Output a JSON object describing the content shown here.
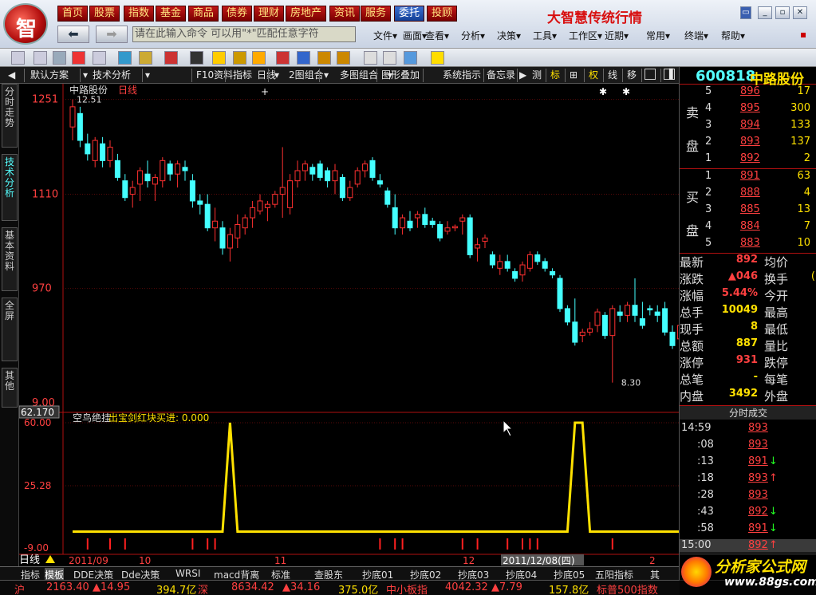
{
  "app": {
    "title": "大智慧传统行情",
    "logo_char": "智"
  },
  "nav": [
    "首页",
    "股票",
    "指数",
    "基金",
    "商品",
    "债券",
    "理财",
    "房地产",
    "资讯",
    "服务",
    "委托",
    "投顾"
  ],
  "command": {
    "placeholder": "请在此输入命令   可以用\"*\"匹配任意字符"
  },
  "menu": [
    "文件▾",
    "画面▾",
    "查看▾",
    "分析▾",
    "决策▾",
    "工具▾",
    "工作区▾",
    "近期▾",
    "常用▾",
    "终端▾",
    "帮助▾"
  ],
  "window_buttons": [
    "_",
    "▫",
    "✕"
  ],
  "tabs": [
    "◀",
    "默认方案",
    "▾",
    "技术分析",
    "▾",
    "F10资料",
    "指标",
    "日线",
    "▾",
    "2图组合",
    "▾",
    "多图组合",
    "▾",
    "图形叠加",
    "系统指示",
    "备忘录",
    "▶",
    "测",
    "标",
    "⊞",
    "权",
    "线",
    "移"
  ],
  "side_tabs": [
    "分时走势",
    "技术分析",
    "基本资料",
    "全屏",
    "其他"
  ],
  "stock": {
    "code": "600818",
    "name": "中路股份",
    "period": "日线"
  },
  "main_chart": {
    "high_label": "12.51",
    "low_label": "8.30",
    "y_ticks": [
      "1251",
      "1110",
      "970",
      "9.00"
    ],
    "left_readout": "62.170"
  },
  "indicator": {
    "name": "空鸟绝挂",
    "signal_label": "出宝剑红块买进: 0.000",
    "y_ticks": [
      "60.00",
      "25.28",
      "-9.00"
    ]
  },
  "x_labels": [
    "2011/09",
    "10",
    "11",
    "12",
    "2011/12/08(四)",
    "2"
  ],
  "period_label": "日线",
  "chart_data": {
    "type": "candlestick",
    "ylim": [
      8.0,
      12.6
    ],
    "candles": [
      [
        12.1,
        12.51,
        11.9,
        12.4
      ],
      [
        12.3,
        12.4,
        11.8,
        11.9
      ],
      [
        11.85,
        12.0,
        11.6,
        11.7
      ],
      [
        11.6,
        11.95,
        11.5,
        11.9
      ],
      [
        11.85,
        11.95,
        11.5,
        11.6
      ],
      [
        11.6,
        11.9,
        11.5,
        11.8
      ],
      [
        11.6,
        11.7,
        11.3,
        11.35
      ],
      [
        11.3,
        11.4,
        11.0,
        11.05
      ],
      [
        11.1,
        11.3,
        10.9,
        11.2
      ],
      [
        11.25,
        11.5,
        11.0,
        11.45
      ],
      [
        11.4,
        11.6,
        11.2,
        11.3
      ],
      [
        11.25,
        11.4,
        11.0,
        11.35
      ],
      [
        11.3,
        11.65,
        11.2,
        11.6
      ],
      [
        11.55,
        11.6,
        11.3,
        11.4
      ],
      [
        11.4,
        11.6,
        11.2,
        11.55
      ],
      [
        11.5,
        11.6,
        11.3,
        11.45
      ],
      [
        11.3,
        11.4,
        10.9,
        11.0
      ],
      [
        11.0,
        11.1,
        10.8,
        10.95
      ],
      [
        10.95,
        11.1,
        10.55,
        10.6
      ],
      [
        10.6,
        10.9,
        10.4,
        10.7
      ],
      [
        10.6,
        10.7,
        10.2,
        10.3
      ],
      [
        10.3,
        10.6,
        10.1,
        10.5
      ],
      [
        10.45,
        10.8,
        10.3,
        10.65
      ],
      [
        10.6,
        10.8,
        10.5,
        10.75
      ],
      [
        10.75,
        11.0,
        10.6,
        10.9
      ],
      [
        10.85,
        11.1,
        10.8,
        11.0
      ],
      [
        10.9,
        11.0,
        10.7,
        10.95
      ],
      [
        10.95,
        11.15,
        10.9,
        11.1
      ],
      [
        11.1,
        11.8,
        10.75,
        11.2
      ],
      [
        10.9,
        11.4,
        10.8,
        11.3
      ],
      [
        11.3,
        11.6,
        11.2,
        11.45
      ],
      [
        11.45,
        11.6,
        11.3,
        11.55
      ],
      [
        11.5,
        11.55,
        11.3,
        11.4
      ],
      [
        11.55,
        11.6,
        11.3,
        11.35
      ],
      [
        11.45,
        11.5,
        11.2,
        11.3
      ],
      [
        11.3,
        11.55,
        11.1,
        11.45
      ],
      [
        11.35,
        11.4,
        11.0,
        11.05
      ],
      [
        11.05,
        11.3,
        11.0,
        11.2
      ],
      [
        11.25,
        11.5,
        11.2,
        11.45
      ],
      [
        11.45,
        11.6,
        11.35,
        11.55
      ],
      [
        11.6,
        11.65,
        11.3,
        11.35
      ],
      [
        11.3,
        11.4,
        11.2,
        11.25
      ],
      [
        11.15,
        11.2,
        10.9,
        10.95
      ],
      [
        10.9,
        11.1,
        10.5,
        10.6
      ],
      [
        10.6,
        10.8,
        10.5,
        10.75
      ],
      [
        10.7,
        10.85,
        10.55,
        10.6
      ],
      [
        10.75,
        10.85,
        10.6,
        10.8
      ],
      [
        10.8,
        10.9,
        10.6,
        10.65
      ],
      [
        10.7,
        10.75,
        10.6,
        10.65
      ],
      [
        10.65,
        10.7,
        10.4,
        10.45
      ],
      [
        10.55,
        10.7,
        10.5,
        10.6
      ],
      [
        10.6,
        10.65,
        10.55,
        10.62
      ],
      [
        10.7,
        10.8,
        10.5,
        10.75
      ],
      [
        10.75,
        10.8,
        10.15,
        10.2
      ],
      [
        10.3,
        10.45,
        10.1,
        10.35
      ],
      [
        10.4,
        10.5,
        10.3,
        10.45
      ],
      [
        10.2,
        10.25,
        10.0,
        10.05
      ],
      [
        10.0,
        10.2,
        9.9,
        10.1
      ],
      [
        10.1,
        10.2,
        9.95,
        10.0
      ],
      [
        9.95,
        10.0,
        9.8,
        9.85
      ],
      [
        9.9,
        10.1,
        9.8,
        10.05
      ],
      [
        10.0,
        10.25,
        9.95,
        10.2
      ],
      [
        10.2,
        10.25,
        10.05,
        10.1
      ],
      [
        10.1,
        10.15,
        9.95,
        10.0
      ],
      [
        9.95,
        10.0,
        9.85,
        9.9
      ],
      [
        9.85,
        9.9,
        9.35,
        9.4
      ],
      [
        9.4,
        9.45,
        9.15,
        9.2
      ],
      [
        9.2,
        9.55,
        8.85,
        8.9
      ],
      [
        9.0,
        9.1,
        8.9,
        9.05
      ],
      [
        9.05,
        9.2,
        9.0,
        9.1
      ],
      [
        9.15,
        9.4,
        9.05,
        9.35
      ],
      [
        9.3,
        9.35,
        8.95,
        9.0
      ],
      [
        9.0,
        9.45,
        8.3,
        9.4
      ],
      [
        9.35,
        9.45,
        9.2,
        9.3
      ],
      [
        9.3,
        9.5,
        9.2,
        9.45
      ],
      [
        9.45,
        9.85,
        9.2,
        9.3
      ],
      [
        9.25,
        9.5,
        9.1,
        9.15
      ],
      [
        9.4,
        9.45,
        9.3,
        9.38
      ],
      [
        9.35,
        9.45,
        9.2,
        9.3
      ],
      [
        9.4,
        9.5,
        9.0,
        9.05
      ],
      [
        9.05,
        9.15,
        8.8,
        8.85
      ],
      [
        8.95,
        9.2,
        8.9,
        9.15
      ]
    ],
    "indicator_values": [
      0,
      0,
      0,
      0,
      0,
      0,
      0,
      0,
      0,
      0,
      0,
      0,
      0,
      0,
      0,
      0,
      0,
      0,
      0,
      0,
      0,
      60,
      0,
      0,
      0,
      0,
      0,
      0,
      0,
      0,
      0,
      0,
      0,
      0,
      0,
      0,
      0,
      0,
      0,
      0,
      0,
      0,
      0,
      0,
      0,
      0,
      0,
      0,
      0,
      0,
      0,
      0,
      0,
      0,
      0,
      0,
      0,
      0,
      0,
      0,
      0,
      0,
      0,
      0,
      0,
      0,
      0,
      60,
      60,
      0,
      0,
      0,
      0,
      0,
      0,
      0,
      0,
      0,
      0,
      0,
      0,
      0
    ],
    "signal_days": [
      2,
      5,
      7,
      16,
      18,
      19,
      41,
      43,
      44,
      52,
      54,
      58,
      60,
      61,
      62,
      72
    ]
  },
  "quote": {
    "sell": [
      {
        "n": "5",
        "p": "896",
        "v": "17"
      },
      {
        "n": "4",
        "p": "895",
        "v": "300"
      },
      {
        "n": "3",
        "p": "894",
        "v": "133"
      },
      {
        "n": "2",
        "p": "893",
        "v": "137"
      },
      {
        "n": "1",
        "p": "892",
        "v": "2"
      }
    ],
    "buy": [
      {
        "n": "1",
        "p": "891",
        "v": "63"
      },
      {
        "n": "2",
        "p": "888",
        "v": "4"
      },
      {
        "n": "3",
        "p": "885",
        "v": "13"
      },
      {
        "n": "4",
        "p": "884",
        "v": "7"
      },
      {
        "n": "5",
        "p": "883",
        "v": "10"
      }
    ],
    "sell_label": [
      "卖",
      "盘"
    ],
    "buy_label": [
      "买",
      "盘"
    ],
    "stats": [
      {
        "k": "最新",
        "v": "892",
        "k2": "均价",
        "v2": ""
      },
      {
        "k": "涨跌",
        "v": "▲046",
        "k2": "换手",
        "v2": "("
      },
      {
        "k": "涨幅",
        "v": "5.44%",
        "k2": "今开",
        "v2": ""
      },
      {
        "k": "总手",
        "v": "10049",
        "k2": "最高",
        "v2": ""
      },
      {
        "k": "现手",
        "v": "8",
        "k2": "最低",
        "v2": ""
      },
      {
        "k": "总额",
        "v": "887",
        "k2": "量比",
        "v2": ""
      },
      {
        "k": "涨停",
        "v": "931",
        "k2": "跌停",
        "v2": ""
      },
      {
        "k": "总笔",
        "v": "-",
        "k2": "每笔",
        "v2": ""
      },
      {
        "k": "内盘",
        "v": "3492",
        "k2": "外盘",
        "v2": ""
      }
    ],
    "ticks_title": "分时成交",
    "ticks": [
      {
        "t": "14:59",
        "p": "893",
        "a": ""
      },
      {
        "t": ":08",
        "p": "893",
        "a": ""
      },
      {
        "t": ":13",
        "p": "891",
        "a": "↓"
      },
      {
        "t": ":18",
        "p": "893",
        "a": "↑"
      },
      {
        "t": ":28",
        "p": "893",
        "a": ""
      },
      {
        "t": ":43",
        "p": "892",
        "a": "↓"
      },
      {
        "t": ":58",
        "p": "891",
        "a": "↓"
      },
      {
        "t": "15:00",
        "p": "892",
        "a": "↑"
      }
    ]
  },
  "bottom_tabs": [
    "指标",
    "模板",
    "DDE决策",
    "Dde决策",
    "WRSI",
    "macd背离",
    "标准",
    "查股东",
    "抄底01",
    "抄底02",
    "抄底03",
    "抄底04",
    "抄底05",
    "五阳指标",
    "其"
  ],
  "ticker": [
    {
      "t": "沪",
      "c": "#ff4040"
    },
    {
      "t": "2163.40",
      "c": "#ff4040"
    },
    {
      "t": "▲14.95",
      "c": "#ff4040"
    },
    {
      "t": "394.7亿",
      "c": "#ffe100"
    },
    {
      "t": "深",
      "c": "#ff4040"
    },
    {
      "t": "8634.42",
      "c": "#ff4040"
    },
    {
      "t": "▲34.16",
      "c": "#ff4040"
    },
    {
      "t": "375.0亿",
      "c": "#ffe100"
    },
    {
      "t": "中小板指",
      "c": "#ff4040"
    },
    {
      "t": "4042.32",
      "c": "#ff4040"
    },
    {
      "t": "▲7.79",
      "c": "#ff4040"
    },
    {
      "t": "157.8亿",
      "c": "#ffe100"
    },
    {
      "t": "标普500指数",
      "c": "#ff4040"
    }
  ],
  "watermark": {
    "line1": "分析家公式网",
    "line2": "www.88gs.com"
  }
}
